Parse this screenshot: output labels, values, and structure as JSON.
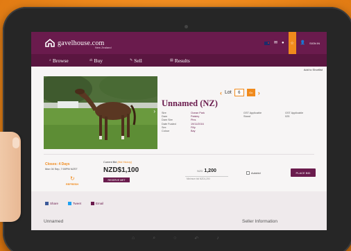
{
  "app": {
    "brand_name": "gavelhouse.com",
    "brand_sub": "New Zealand",
    "signin_label": "SIGN IN"
  },
  "nav": {
    "items": [
      {
        "label": "Browse"
      },
      {
        "label": "Buy"
      },
      {
        "label": "Sell"
      },
      {
        "label": "Results"
      }
    ]
  },
  "shortlist_label": "Add to Shortlist",
  "lot": {
    "label": "Lot",
    "number": "6",
    "go_label": "Go"
  },
  "listing": {
    "title": "Unnamed (NZ)",
    "details": [
      {
        "key": "Sire",
        "value": "Ocean Park"
      },
      {
        "key": "Dam",
        "value": "Paisley"
      },
      {
        "key": "Dam Sire",
        "value": "Pins"
      },
      {
        "key": "Date Foaled",
        "value": "19/11/2016"
      },
      {
        "key": "Sex",
        "value": "Filly"
      },
      {
        "key": "Colour",
        "value": "Bay"
      }
    ],
    "details2": [
      {
        "key": "GST Applicable",
        "value": "GST Applicable"
      },
      {
        "key": "Stand",
        "value": "025"
      }
    ]
  },
  "auction": {
    "closes_label": "Closes: 4 Days",
    "closes_date": "Mon 04 Sep, 7:00PM NZST",
    "refresh_label": "REFRESH",
    "current_bid_label": "Current Bid",
    "bid_history_link": "(Bid History)",
    "current_bid": "NZD$1,100",
    "reserve_label": "RESERVE MET",
    "bid_currency": "NZD",
    "bid_value": "1,200",
    "min_bid_note": "Minimum bid NZD1,200",
    "autobid_label": "Autobid",
    "place_bid_label": "PLACE BID"
  },
  "share": {
    "items": [
      {
        "label": "Share",
        "color": "#3b5998"
      },
      {
        "label": "Tweet",
        "color": "#1da1f2"
      },
      {
        "label": "Email",
        "color": "#6a1b4d"
      }
    ]
  },
  "lower": {
    "title": "Unnamed",
    "seller_title": "Seller Information"
  },
  "colors": {
    "brand": "#6a1b4d",
    "accent": "#f08a1c"
  }
}
